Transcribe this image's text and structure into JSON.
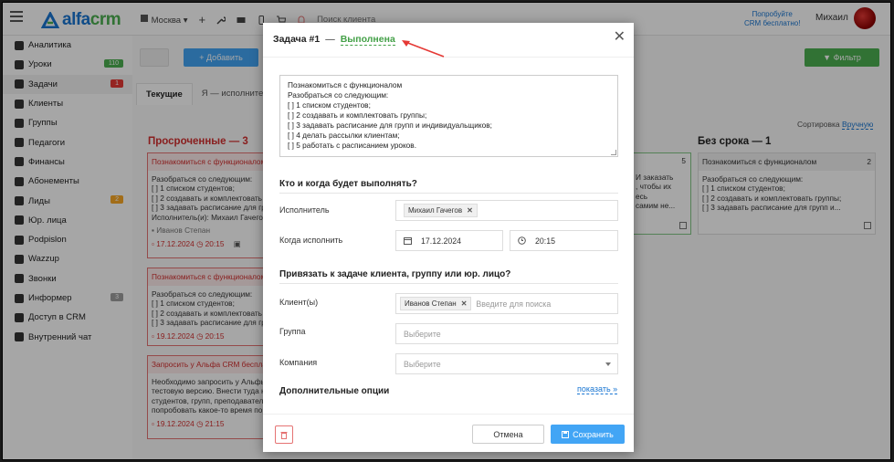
{
  "header": {
    "logo_text": "alfa",
    "logo_accent": "crm",
    "city": "Москва",
    "search_hint": "Поиск клиента",
    "try_line1": "Попробуйте",
    "try_line2": "CRM бесплатно!",
    "user_name": "Михаил"
  },
  "sidebar": {
    "items": [
      {
        "label": "Аналитика",
        "icon": "chart-icon"
      },
      {
        "label": "Уроки",
        "icon": "calendar-icon",
        "badge": "110"
      },
      {
        "label": "Задачи",
        "icon": "tasks-icon",
        "badge": "1"
      },
      {
        "label": "Клиенты",
        "icon": "user-icon"
      },
      {
        "label": "Группы",
        "icon": "users-icon"
      },
      {
        "label": "Педагоги",
        "icon": "graduation-icon"
      },
      {
        "label": "Финансы",
        "icon": "money-icon"
      },
      {
        "label": "Абонементы",
        "icon": "tag-icon"
      },
      {
        "label": "Лиды",
        "icon": "funnel-icon",
        "badge": "2"
      },
      {
        "label": "Юр. лица",
        "icon": "building-icon"
      },
      {
        "label": "Podpislon",
        "icon": "document-icon"
      },
      {
        "label": "Wazzup",
        "icon": "whatsapp-icon"
      },
      {
        "label": "Звонки",
        "icon": "phone-icon"
      },
      {
        "label": "Информер",
        "icon": "message-icon",
        "badge": "3"
      },
      {
        "label": "Доступ в CRM",
        "icon": "lock-icon"
      },
      {
        "label": "Внутренний чат",
        "icon": "chat-icon"
      }
    ]
  },
  "toolbar": {
    "add_label": "+ Добавить",
    "filter_label": "Фильтр"
  },
  "tabs": [
    "Текущие",
    "Я — исполнитель"
  ],
  "sort": {
    "label": "Сортировка",
    "value": "Вручную"
  },
  "columns": {
    "overdue": "Просроченные — 3",
    "no_deadline": "Без срока — 1"
  },
  "cards": [
    {
      "title": "Познакомиться с функционалом",
      "lines": [
        "Разобраться со следующим:",
        "[ ] 1 списком студентов;",
        "[ ] 2 создавать и комплектовать гр",
        "[ ] 3 задавать расписание для гру"
      ],
      "executor": "Исполнитель(и): Михаил Гачегов",
      "client": "Иванов Степан",
      "date": "17.12.2024",
      "time": "20:15"
    },
    {
      "title": "Познакомиться с функционалом",
      "lines": [
        "Разобраться со следующим:",
        "[ ] 1 списком студентов;",
        "[ ] 2 создавать и комплектовать гр",
        "[ ] 3 задавать расписание для гру"
      ],
      "date": "19.12.2024",
      "time": "20:15"
    },
    {
      "title": "Запросить у Альфа CRM бесплатную",
      "lines": [
        "Необходимо запросить у Альфы",
        "тестовую версию. Внести туда не",
        "студентов, групп, преподавателей",
        "попробовать какое-то время пор"
      ],
      "date": "19.12.2024",
      "time": "21:15"
    }
  ],
  "mid_card": {
    "count": "5",
    "lines": [
      "И заказать",
      ", чтобы их",
      "есь",
      "самим не..."
    ]
  },
  "nd_card": {
    "title": "Познакомиться с функционалом",
    "count": "2",
    "lines": [
      "Разобраться со следующим:",
      "[ ] 1 списком студентов;",
      "[ ] 2 создавать и комплектовать группы;",
      "[ ] 3 задавать расписание для групп и..."
    ]
  },
  "modal": {
    "title": "Задача #1",
    "dash": "—",
    "status": "Выполнена",
    "description_lines": [
      "Познакомиться с функционалом",
      "Разобраться со следующим:",
      "[ ] 1 списком студентов;",
      "[ ] 2 создавать и комплектовать группы;",
      "[ ] 3 задавать расписание для групп и индивидуальщиков;",
      "[ ] 4 делать рассылки клиентам;",
      "[ ] 5 работать с расписанием уроков."
    ],
    "section_who": "Кто и когда будет выполнять?",
    "executor_label": "Исполнитель",
    "executor_value": "Михаил Гачегов",
    "when_label": "Когда исполнить",
    "date_value": "17.12.2024",
    "time_value": "20:15",
    "section_link": "Привязать к задаче клиента, группу или юр. лицо?",
    "client_label": "Клиент(ы)",
    "client_value": "Иванов Степан",
    "client_placeholder": "Введите для поиска",
    "group_label": "Группа",
    "group_placeholder": "Выберите",
    "company_label": "Компания",
    "company_placeholder": "Выберите",
    "extra_label": "Дополнительные опции",
    "show_label": "показать »",
    "cancel_label": "Отмена",
    "save_label": "Сохранить"
  },
  "colors": {
    "brand": "#1976d2",
    "accent_green": "#43a047",
    "danger": "#d32f2f",
    "save_blue": "#42a5f5"
  }
}
